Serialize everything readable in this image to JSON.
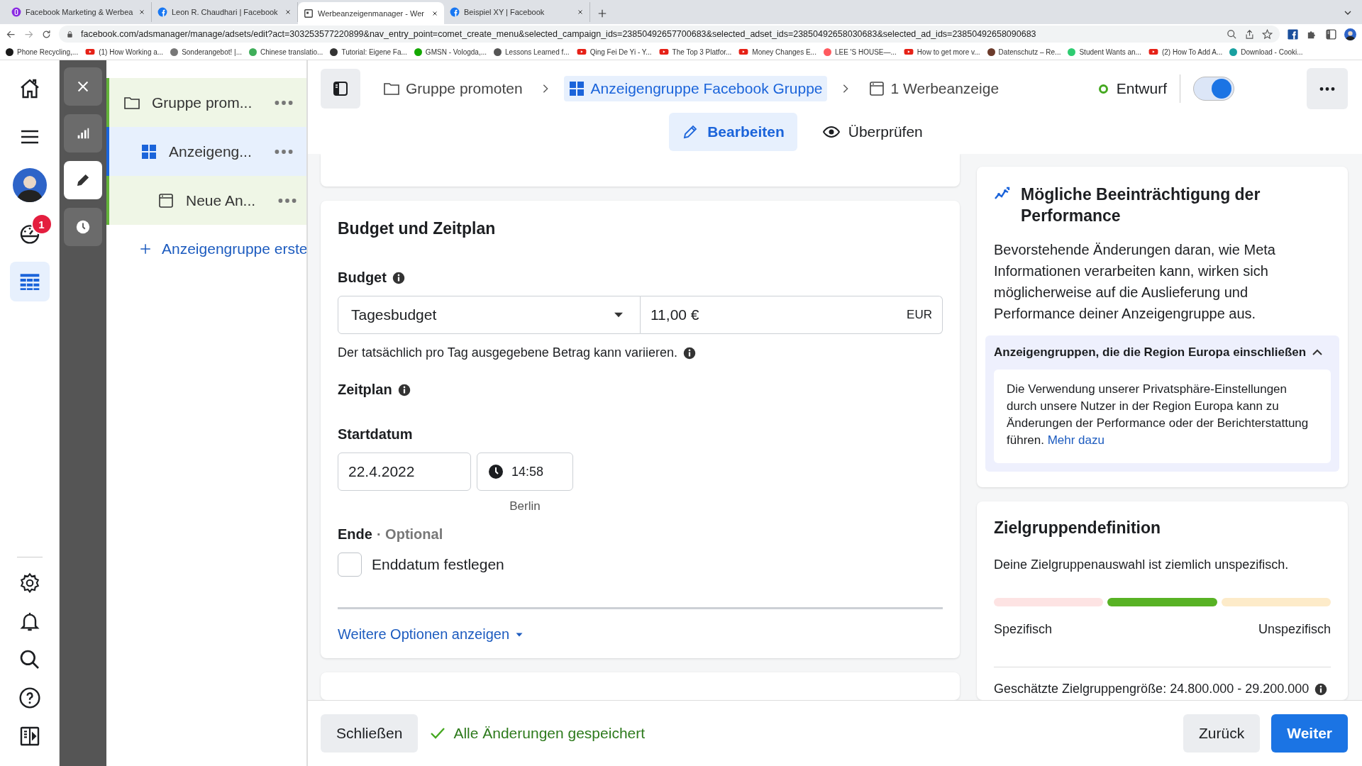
{
  "browser": {
    "tabs": [
      {
        "title": "Facebook Marketing & Werbea",
        "kind": "course",
        "selected": false
      },
      {
        "title": "Leon R. Chaudhari | Facebook",
        "kind": "facebook",
        "selected": false
      },
      {
        "title": "Werbeanzeigenmanager - Wer",
        "kind": "page",
        "selected": true
      },
      {
        "title": "Beispiel XY | Facebook",
        "kind": "facebook",
        "selected": false
      }
    ],
    "url": "facebook.com/adsmanager/manage/adsets/edit?act=303253577220899&nav_entry_point=comet_create_menu&selected_campaign_ids=23850492657700683&selected_adset_ids=23850492658030683&selected_ad_ids=23850492658090683",
    "bookmarks": [
      {
        "kind": "site",
        "color": "#1a1a1a",
        "title": "Phone Recycling,..."
      },
      {
        "kind": "youtube",
        "title": "(1) How Working a..."
      },
      {
        "kind": "site",
        "color": "#777777",
        "title": "Sonderangebot! |..."
      },
      {
        "kind": "site",
        "color": "#3fae5a",
        "title": "Chinese translatio..."
      },
      {
        "kind": "site",
        "color": "#333333",
        "title": "Tutorial: Eigene Fa..."
      },
      {
        "kind": "site",
        "color": "#14a800",
        "title": "GMSN - Vologda,..."
      },
      {
        "kind": "site",
        "color": "#555555",
        "title": "Lessons Learned f..."
      },
      {
        "kind": "youtube",
        "title": "Qing Fei De Yi - Y..."
      },
      {
        "kind": "youtube",
        "title": "The Top 3 Platfor..."
      },
      {
        "kind": "youtube",
        "title": "Money Changes E..."
      },
      {
        "kind": "site",
        "color": "#ff5a5f",
        "title": "LEE 'S HOUSE—..."
      },
      {
        "kind": "youtube",
        "title": "How to get more v..."
      },
      {
        "kind": "site",
        "color": "#6b3a2a",
        "title": "Datenschutz – Re..."
      },
      {
        "kind": "site",
        "color": "#2ecc71",
        "title": "Student Wants an..."
      },
      {
        "kind": "youtube",
        "title": "(2) How To Add A..."
      },
      {
        "kind": "site",
        "color": "#18a0a0",
        "title": "Download - Cooki..."
      }
    ]
  },
  "nav_rail": {
    "top": [
      {
        "kind": "home",
        "selected": false
      },
      {
        "kind": "menu",
        "selected": false
      },
      {
        "kind": "avatar",
        "selected": false
      },
      {
        "kind": "gauge",
        "selected": false,
        "badge": "1"
      },
      {
        "kind": "table",
        "selected": true
      }
    ],
    "bottom": [
      {
        "kind": "gear",
        "selected": false
      },
      {
        "kind": "bell",
        "selected": false
      },
      {
        "kind": "search",
        "selected": false
      },
      {
        "kind": "help",
        "selected": false
      },
      {
        "kind": "panel",
        "selected": false
      }
    ]
  },
  "tool_rail": [
    {
      "kind": "close",
      "selected": false
    },
    {
      "kind": "chart",
      "selected": false
    },
    {
      "kind": "pencil",
      "selected": true
    },
    {
      "kind": "clock",
      "selected": false
    }
  ],
  "tree": {
    "items": [
      {
        "kind": "campaign",
        "label": "Gruppe prom...",
        "selected": false,
        "children": [
          {
            "kind": "adset",
            "label": "Anzeigeng...",
            "selected": true,
            "children": [
              {
                "kind": "ad",
                "label": "Neue An...",
                "selected": false
              }
            ]
          }
        ]
      }
    ],
    "create_link": "Anzeigengruppe erste"
  },
  "header": {
    "breadcrumbs": [
      {
        "kind": "campaign",
        "label": "Gruppe promoten",
        "selected": false
      },
      {
        "kind": "adset",
        "label": "Anzeigengruppe Facebook Gruppe",
        "selected": true
      },
      {
        "kind": "ad",
        "label": "1 Werbeanzeige",
        "selected": false
      }
    ],
    "status": "Entwurf",
    "toggle": {
      "on": true
    },
    "tabs": [
      {
        "kind": "edit",
        "label": "Bearbeiten",
        "selected": true
      },
      {
        "kind": "review",
        "label": "Überprüfen",
        "selected": false
      }
    ]
  },
  "budget_card": {
    "title": "Budget und Zeitplan",
    "budget_label": "Budget",
    "budget_type": "Tagesbudget",
    "amount": "11,00 €",
    "currency": "EUR",
    "budget_note": "Der tatsächlich pro Tag ausgegebene Betrag kann variieren.",
    "schedule_label": "Zeitplan",
    "start_label": "Startdatum",
    "start_date": "22.4.2022",
    "start_time": "14:58",
    "timezone": "Berlin",
    "end_label": "Ende",
    "end_hint": "· Optional",
    "end_checkbox": {
      "label": "Enddatum festlegen",
      "checked": false
    },
    "more_options": "Weitere Optionen anzeigen"
  },
  "performance_card": {
    "title": "Mögliche Beeinträchtigung der Performance",
    "body": "Bevorstehende Änderungen daran, wie Meta Informationen verarbeiten kann, wirken sich möglicherweise auf die Auslieferung und Performance deiner Anzeigengruppe aus.",
    "notice": {
      "title": "Anzeigengruppen, die die Region Europa einschließen",
      "expanded": true,
      "body": "Die Verwendung unserer Privatsphäre-Einstellungen durch unsere Nutzer in der Region Europa kann zu Änderungen der Performance oder der Berichterstattung führen.",
      "link": "Mehr dazu"
    }
  },
  "audience_card": {
    "title": "Zielgruppendefinition",
    "summary": "Deine Zielgruppenauswahl ist ziemlich unspezifisch.",
    "meter": [
      {
        "color": "#fde3e3"
      },
      {
        "color": "#58b224"
      },
      {
        "color": "#fdebc9"
      }
    ],
    "min_label": "Spezifisch",
    "max_label": "Unspezifisch",
    "size": "Geschätzte Zielgruppengröße: 24.800.000 - 29.200.000"
  },
  "footer": {
    "close": "Schließen",
    "saved": "Alle Änderungen gespeichert",
    "back": "Zurück",
    "next": "Weiter"
  }
}
